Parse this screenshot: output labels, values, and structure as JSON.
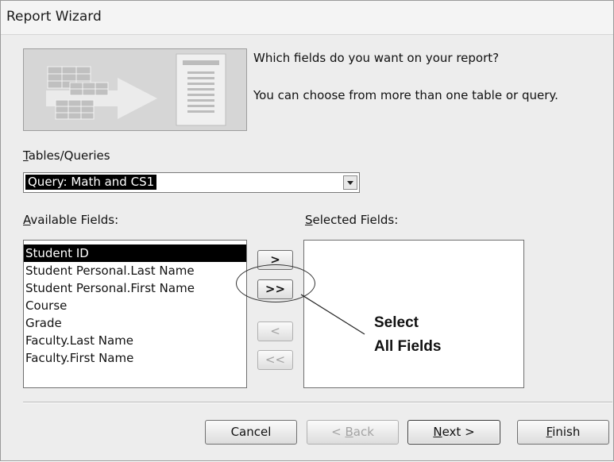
{
  "window": {
    "title": "Report Wizard"
  },
  "prompt": {
    "line1": "Which fields do you want on your report?",
    "line2": "You can choose from more than one table or query."
  },
  "tables_queries": {
    "label": "Tables/Queries",
    "selected": "Query: Math and CS1"
  },
  "available": {
    "label": "Available Fields:",
    "items": [
      "Student ID",
      "Student Personal.Last Name",
      "Student Personal.First Name",
      "Course",
      "Grade",
      "Faculty.Last Name",
      "Faculty.First Name"
    ],
    "selected_index": 0
  },
  "selected": {
    "label": "Selected Fields:",
    "items": []
  },
  "move_buttons": {
    "add_one": ">",
    "add_all": ">>",
    "remove_one": "<",
    "remove_all": "<<"
  },
  "annotation": {
    "line1": "Select",
    "line2": "All Fields"
  },
  "footer": {
    "cancel": "Cancel",
    "back": "< Back",
    "next": "Next >",
    "finish": "Finish"
  }
}
